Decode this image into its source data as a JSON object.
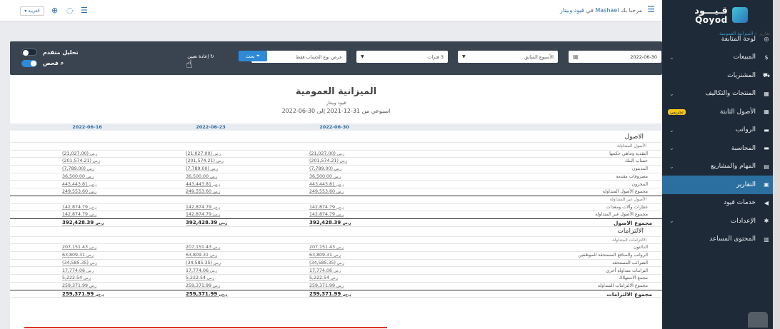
{
  "colors": {
    "sidebar": "#1e2a38",
    "active": "#2a6fa0",
    "accent": "#2e8ad6",
    "badge": "#f5c518",
    "filterbar": "#3a4350",
    "toggle_on": "#2e8ad6",
    "toggle_off": "#1e2a38"
  },
  "logo": {
    "ar": "قـيـــود",
    "en": "Qoyod"
  },
  "sidebar": {
    "items": [
      {
        "label": "لوحة المتابعة",
        "icon": "dashboard-icon",
        "glyph": "◎",
        "chev": false,
        "active": false
      },
      {
        "label": "المبيعات",
        "icon": "dollar-icon",
        "glyph": "$",
        "chev": true,
        "active": false
      },
      {
        "label": "المشتريات",
        "icon": "cart-icon",
        "glyph": "⛟",
        "chev": false,
        "active": false
      },
      {
        "label": "المنتجات والتكاليف",
        "icon": "grid-icon",
        "glyph": "▦",
        "chev": true,
        "active": false
      },
      {
        "label": "الأصول الثابتة",
        "icon": "grid-icon",
        "glyph": "▦",
        "chev": true,
        "active": false,
        "badge": "تجريبي"
      },
      {
        "label": "الرواتب",
        "icon": "folder-icon",
        "glyph": "▬",
        "chev": true,
        "active": false
      },
      {
        "label": "المحاسبة",
        "icon": "folder-icon",
        "glyph": "▬",
        "chev": true,
        "active": false
      },
      {
        "label": "المهام والمشاريع",
        "icon": "list-icon",
        "glyph": "▤",
        "chev": true,
        "active": false
      },
      {
        "label": "التقارير",
        "icon": "report-icon",
        "glyph": "▣",
        "chev": false,
        "active": true
      },
      {
        "label": "خدمات قيود",
        "icon": "arrow-icon",
        "glyph": "◀",
        "chev": false,
        "active": false
      },
      {
        "label": "الإعدادات",
        "icon": "gear-icon",
        "glyph": "✱",
        "chev": true,
        "active": false
      },
      {
        "label": "المحتوى المساعد",
        "icon": "book-icon",
        "glyph": "▥",
        "chev": false,
        "active": false
      }
    ]
  },
  "topbar": {
    "lang": "العربية",
    "welcome_pre": "مرحبا بك",
    "user": "Mashael",
    "welcome_mid": "في",
    "company": "قيود وبيتار"
  },
  "breadcrumb": {
    "root": "تقارير",
    "sep": "»",
    "current": "الميزانية العمومية"
  },
  "filters": {
    "date": "2022-06-30",
    "period": "الأسبوع السابق",
    "count": "3 فترات",
    "account_type": "عرض نوع الحساب فقط",
    "search": "بحث",
    "reset": "إعادة تعيين",
    "advanced": "تحليل متقدم",
    "check": "فحص"
  },
  "report": {
    "title": "الميزانية العمومية",
    "company": "قيود وبيتار",
    "period": "اسبوعي من 31-12-2021 إلى 30-06-2022",
    "columns": [
      "2022-06-30",
      "2022-06-23",
      "2022-06-16"
    ]
  },
  "currency": "ر.س",
  "rows": [
    {
      "type": "h1",
      "label": "الاصول"
    },
    {
      "type": "h2",
      "label": "الأصول المتداولة"
    },
    {
      "type": "line",
      "label": "النقدية وماهي حكمها",
      "values": [
        "(21,027.00)",
        "(21,027.00)",
        "(21,027.00)"
      ]
    },
    {
      "type": "line",
      "label": "حساب البنك",
      "values": [
        "(201,574.21)",
        "(201,574.21)",
        "(201,574.21)"
      ]
    },
    {
      "type": "line",
      "label": "المدينون",
      "values": [
        "(7,789.00)",
        "(7,789.00)",
        "(7,789.00)"
      ]
    },
    {
      "type": "line",
      "label": "مصروفات مقدمة",
      "values": [
        "36,500.00",
        "36,500.00",
        "36,500.00"
      ]
    },
    {
      "type": "line",
      "label": "المخزون",
      "values": [
        "443,443.81",
        "443,443.81",
        "443,443.81"
      ]
    },
    {
      "type": "total",
      "label": "مجموع الأصول المتداولة",
      "values": [
        "249,553.60",
        "249,553.60",
        "249,553.60"
      ]
    },
    {
      "type": "h2",
      "label": "الأصول غير المتداولة"
    },
    {
      "type": "line",
      "label": "عقارات وآلات ومعدات",
      "values": [
        "142,874.79",
        "142,874.79",
        "142,874.79"
      ]
    },
    {
      "type": "total",
      "label": "مجموع الأصول غير المتداولة",
      "values": [
        "142,874.79",
        "142,874.79",
        "142,874.79"
      ]
    },
    {
      "type": "grand",
      "label": "مجموع الاصول",
      "values": [
        "392,428.39",
        "392,428.39",
        "392,428.39"
      ]
    },
    {
      "type": "h1",
      "label": "الالتزامات"
    },
    {
      "type": "h2",
      "label": "الالتزامات المتداولة"
    },
    {
      "type": "line",
      "label": "الدائنون",
      "values": [
        "207,151.43",
        "207,151.43",
        "207,151.43"
      ]
    },
    {
      "type": "line",
      "label": "الرواتب والمنافع المستحقة للموظفين",
      "values": [
        "63,809.31",
        "63,809.31",
        "63,809.31"
      ]
    },
    {
      "type": "line",
      "label": "الضرائب المستحقة",
      "values": [
        "(34,585.35)",
        "(34,585.35)",
        "(34,585.35)"
      ]
    },
    {
      "type": "line",
      "label": "التزامات متداولة أخرى",
      "values": [
        "17,774.06",
        "17,774.06",
        "17,774.06"
      ]
    },
    {
      "type": "line",
      "label": "مجمع الاستهلاك",
      "values": [
        "5,222.54",
        "5,222.54",
        "5,222.54"
      ]
    },
    {
      "type": "total",
      "label": "مجموع الالتزامات المتداولة",
      "values": [
        "259,371.99",
        "259,371.99",
        "259,371.99"
      ]
    },
    {
      "type": "grand",
      "label": "مجموع الالتزامات",
      "values": [
        "259,371.99",
        "259,371.99",
        "259,371.99"
      ]
    }
  ]
}
